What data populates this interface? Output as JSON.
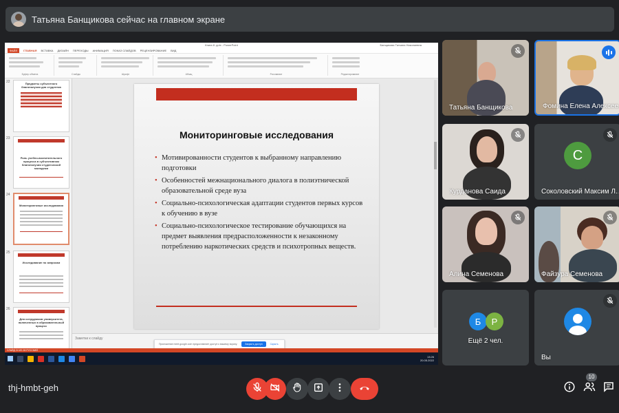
{
  "header": {
    "presenting_text": "Татьяна Банщикова сейчас на главном экране"
  },
  "presentation": {
    "window_title": "Книга 8 .pptx - PowerPoint",
    "user_name": "Банщикова Татьяна Николаевна",
    "tabs": [
      "ФАЙЛ",
      "ГЛАВНАЯ",
      "ВСТАВКА",
      "ДИЗАЙН",
      "ПЕРЕХОДЫ",
      "АНИМАЦИЯ",
      "ПОКАЗ СЛАЙДОВ",
      "РЕЦЕНЗИРОВАНИЕ",
      "ВИД"
    ],
    "ribbon_groups": [
      "Буфер обмена",
      "Слайды",
      "Шрифт",
      "Абзац",
      "Рисование",
      "Редактирование"
    ],
    "thumbnails": [
      {
        "num": "22",
        "title": "Предметы субъектного благополучия для студентов"
      },
      {
        "num": "23",
        "title": "Роль учебно-воспитательного процесса в субъективном благополучии студенческой молодежи"
      },
      {
        "num": "24",
        "title": "Мониторинговые исследования"
      },
      {
        "num": "25",
        "title": "Исследование по запросам"
      },
      {
        "num": "26",
        "title": "Для сотрудников университета, включенных в образовательный процесс"
      }
    ],
    "notes_placeholder": "Заметки к слайду",
    "status_text": "СЛАЙД 24 ИЗ 28   РУССКИЙ",
    "slide": {
      "title": "Мониторинговые исследования",
      "bullets": [
        "Мотивированности студентов к выбранному направлению подготовки",
        "Особенностей межнационального диалога в полиэтнической образовательной среде вуза",
        "Социально-психологическая адаптации студентов первых курсов к обучению в вузе",
        "Социально-психологическое тестирование обучающихся на предмет выявления предрасположенности к незаконному потреблению наркотических средств и психотропных веществ."
      ]
    },
    "sharing_notice": {
      "text": "Приложение meet.google.com предоставляет доступ к вашему экрану.",
      "button": "Закрыть доступ",
      "link": "Скрыть"
    },
    "clock": {
      "time": "13:26",
      "date": "20.05.2022"
    }
  },
  "participants": [
    {
      "name": "Татьяна Банщикова",
      "muted": true
    },
    {
      "name": "Фомина Елена Алексее...",
      "muted": false,
      "speaking": true
    },
    {
      "name": "Курданова Саида",
      "muted": true
    },
    {
      "name": "Соколовский Максим Л...",
      "muted": true,
      "initial": "C",
      "color": "#4e9b3f"
    },
    {
      "name": "Алина Семенова",
      "muted": true
    },
    {
      "name": "Файзура Семенова",
      "muted": true
    },
    {
      "name": "Ещё 2 чел.",
      "muted": true,
      "initials": [
        "Б",
        "Р"
      ],
      "colors": [
        "#1e88e5",
        "#7cb342"
      ]
    },
    {
      "name": "Вы",
      "muted": true
    }
  ],
  "bottombar": {
    "meeting_code": "thj-hmbt-geh",
    "participant_count": "10"
  },
  "icons": {
    "mic": "mic-off-icon",
    "camera": "camera-off-icon",
    "hand": "raise-hand-icon",
    "present": "present-screen-icon",
    "more": "more-options-icon",
    "end": "end-call-icon",
    "info": "info-icon",
    "people": "people-icon",
    "chat": "chat-icon"
  }
}
